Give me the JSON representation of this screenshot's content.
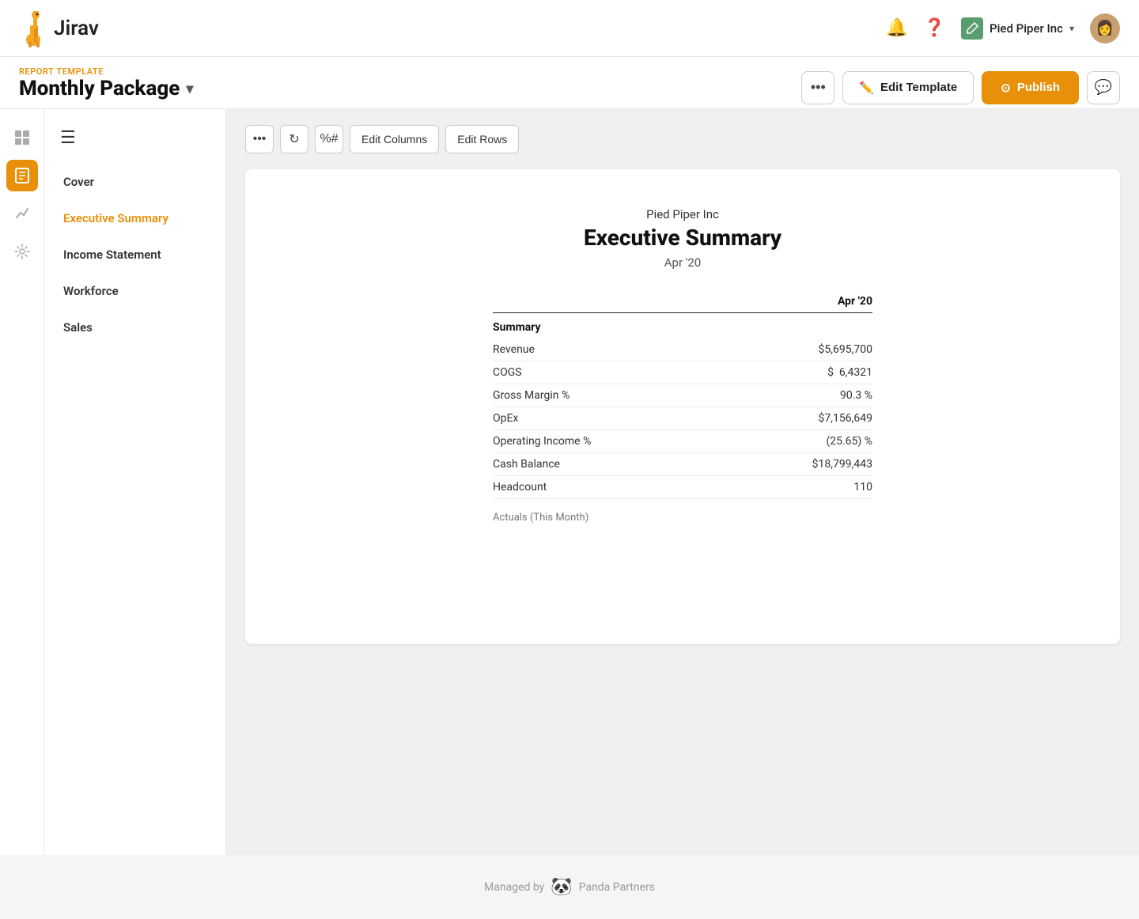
{
  "app": {
    "name": "Jirav"
  },
  "topnav": {
    "company_name": "Pied Piper Inc",
    "chevron": "▾"
  },
  "subheader": {
    "report_label": "REPORT",
    "template_label": "TEMPLATE",
    "report_title": "Monthly Package",
    "chevron": "▾",
    "btn_dots": "•••",
    "btn_edit_template": "Edit Template",
    "btn_publish": "Publish",
    "btn_comment_icon": "💬"
  },
  "icon_sidebar": {
    "items": [
      {
        "icon": "⊞",
        "label": "dashboard-icon",
        "active": false
      },
      {
        "icon": "☰",
        "label": "reports-icon",
        "active": true
      },
      {
        "icon": "↗",
        "label": "analytics-icon",
        "active": false
      },
      {
        "icon": "⚙",
        "label": "settings-icon",
        "active": false
      }
    ]
  },
  "nav_sidebar": {
    "items": [
      {
        "label": "Cover",
        "active": false
      },
      {
        "label": "Executive Summary",
        "active": true
      },
      {
        "label": "Income Statement",
        "active": false
      },
      {
        "label": "Workforce",
        "active": false
      },
      {
        "label": "Sales",
        "active": false
      }
    ]
  },
  "toolbar": {
    "btn_dots": "•••",
    "btn_refresh": "↻",
    "btn_format": "%#",
    "btn_edit_columns": "Edit Columns",
    "btn_edit_rows": "Edit Rows"
  },
  "report": {
    "company_name": "Pied Piper Inc",
    "section_title": "Executive Summary",
    "date": "Apr '20",
    "col_header": "Apr '20",
    "section_label": "Summary",
    "rows": [
      {
        "label": "Revenue",
        "value": "$5,695,700"
      },
      {
        "label": "COGS",
        "value": "$  6,4321"
      },
      {
        "label": "Gross Margin %",
        "value": "90.3 %"
      },
      {
        "label": "OpEx",
        "value": "$7,156,649"
      },
      {
        "label": "Operating Income %",
        "value": "(25.65) %"
      },
      {
        "label": "Cash Balance",
        "value": "$18,799,443"
      },
      {
        "label": "Headcount",
        "value": "110"
      }
    ],
    "actuals_label": "Actuals (This Month)"
  },
  "footer": {
    "text": "Managed by",
    "partner": "Panda Partners"
  }
}
